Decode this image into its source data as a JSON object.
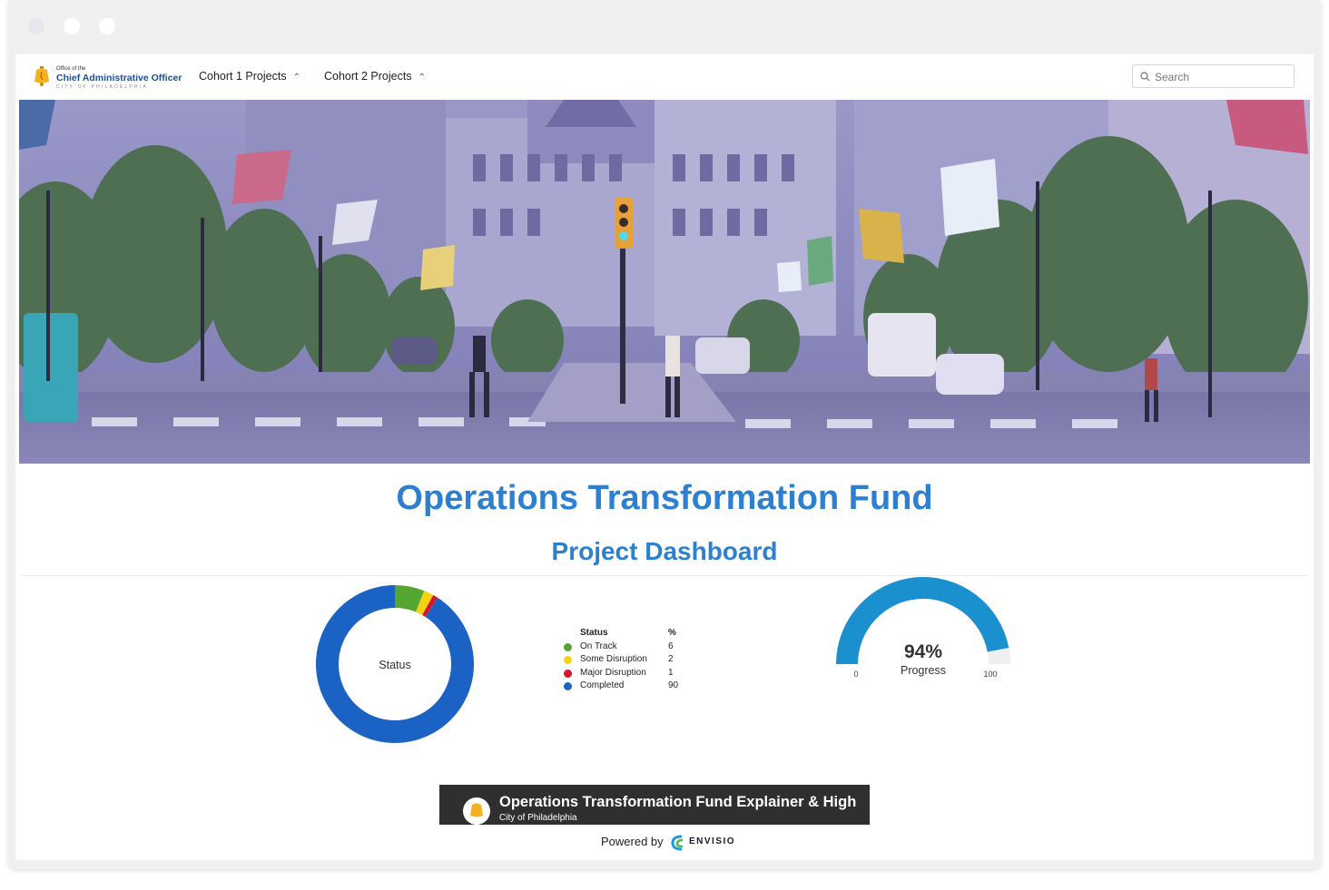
{
  "window": {
    "controls": [
      "close",
      "minimize",
      "maximize"
    ]
  },
  "header": {
    "logo": {
      "line1": "Office of the",
      "line2": "Chief Administrative Officer",
      "line3": "CITY OF PHILADELPHIA",
      "icon": "liberty-bell-icon",
      "colors": {
        "bell": "#f4b223",
        "text": "#1d4f91"
      }
    },
    "nav": [
      {
        "label": "Cohort 1 Projects",
        "icon": "chevron-up-icon"
      },
      {
        "label": "Cohort 2 Projects",
        "icon": "chevron-up-icon"
      }
    ],
    "search": {
      "placeholder": "Search",
      "value": "",
      "icon": "search-icon"
    }
  },
  "hero": {
    "description_icon": "city-street-banner"
  },
  "main": {
    "title": "Operations Transformation Fund",
    "subtitle": "Project Dashboard",
    "accent_color": "#2d7fcf"
  },
  "chart_data": [
    {
      "type": "pie",
      "variant": "donut",
      "center_label": "Status",
      "legend_header": {
        "label": "Status",
        "value": "%"
      },
      "slices": [
        {
          "label": "On Track",
          "value": 6,
          "color": "#55a630"
        },
        {
          "label": "Some Disruption",
          "value": 2,
          "color": "#f4d20f"
        },
        {
          "label": "Major Disruption",
          "value": 1,
          "color": "#d9132a"
        },
        {
          "label": "Completed",
          "value": 90,
          "color": "#1a62c3"
        }
      ]
    },
    {
      "type": "gauge",
      "value": 94,
      "value_label": "94%",
      "label": "Progress",
      "min": 0,
      "max": 100,
      "min_label": "0",
      "max_label": "100",
      "colors": {
        "fill": "#1a90cf",
        "track": "#efefef"
      }
    }
  ],
  "video": {
    "title": "Operations Transformation Fund Explainer & High",
    "channel": "City of Philadelphia"
  },
  "footer": {
    "powered_by": "Powered by",
    "brand": "ENVISIO"
  }
}
